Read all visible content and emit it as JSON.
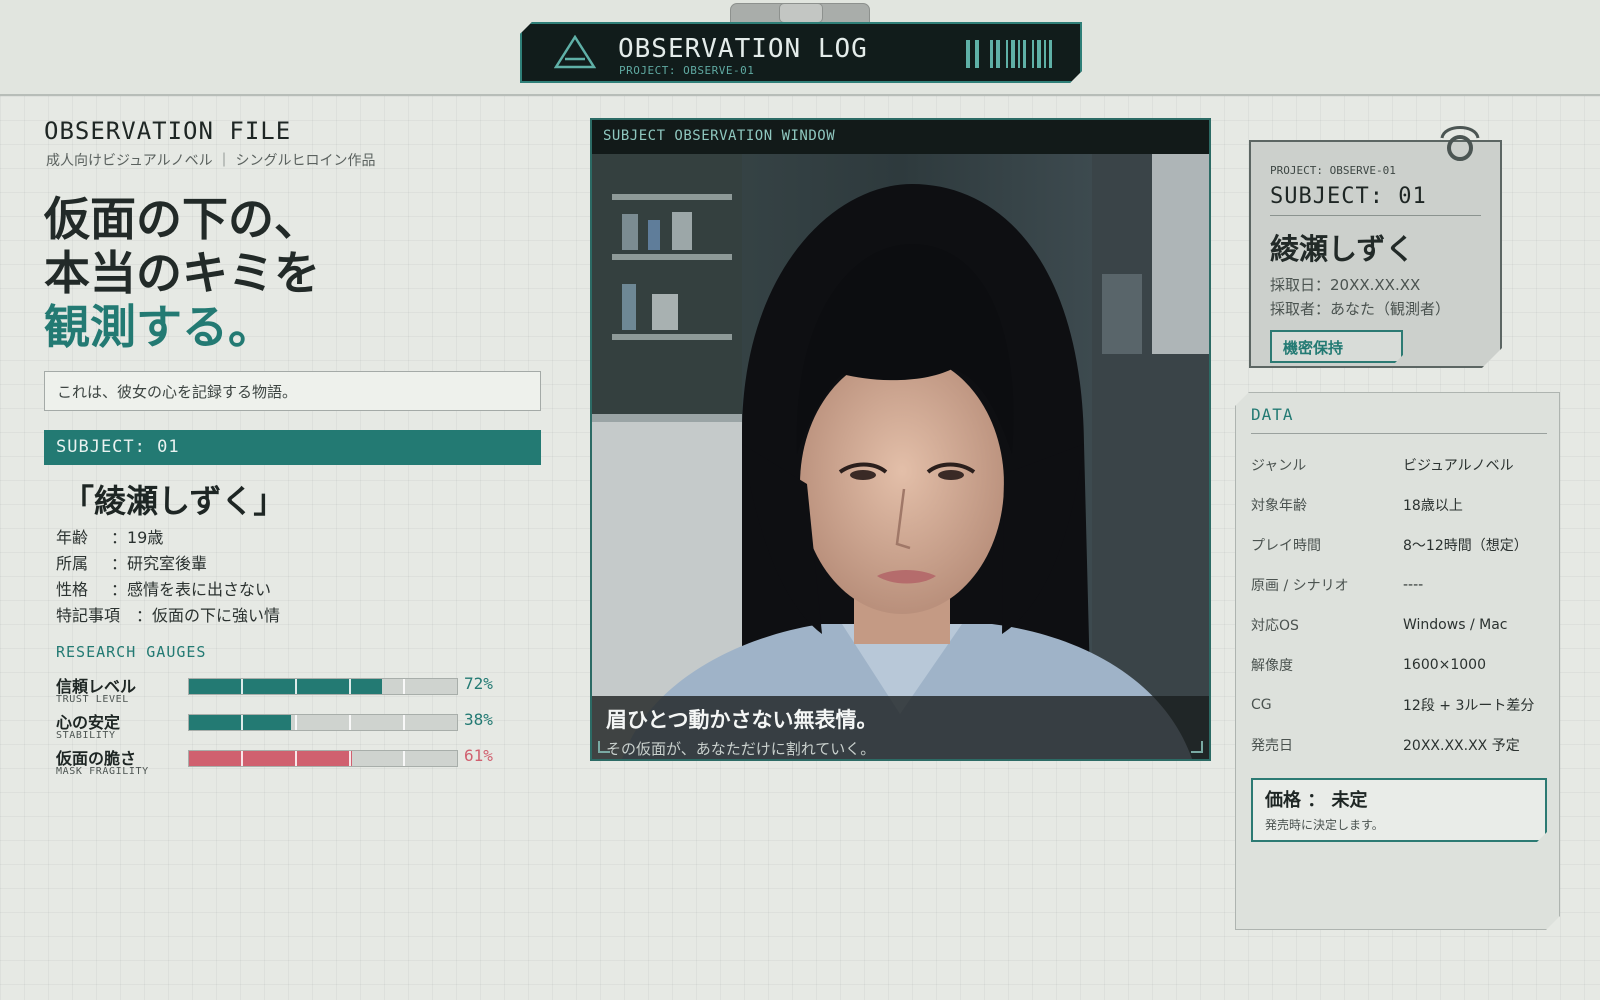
{
  "header": {
    "title": "OBSERVATION LOG",
    "subtitle": "PROJECT: OBSERVE-01",
    "icon": "triangle-icon",
    "barcode_icon": "barcode-icon"
  },
  "file": {
    "title": "OBSERVATION FILE",
    "subtitle": "成人向けビジュアルノベル ｜ シングルヒロイン作品",
    "headline_line1": "仮面の下の、",
    "headline_line2": "本当のキミを",
    "headline_line3": "観測する。",
    "tagline": "これは、彼女の心を記録する物語。"
  },
  "subject": {
    "bar_label": "SUBJECT: 01",
    "name": "「綾瀬しずく」",
    "profile": [
      {
        "key": "年齢",
        "sep": "：",
        "value": "19歳"
      },
      {
        "key": "所属",
        "sep": "：",
        "value": "研究室後輩"
      },
      {
        "key": "性格",
        "sep": "：",
        "value": "感情を表に出さない"
      },
      {
        "key": "特記事項",
        "sep": "：",
        "value": "仮面の下に強い情"
      }
    ]
  },
  "gauges": {
    "title": "RESEARCH GAUGES",
    "items": [
      {
        "label": "信頼レベル",
        "sub": "TRUST LEVEL",
        "value": 72,
        "text": "72%",
        "color": "#237a73"
      },
      {
        "label": "心の安定",
        "sub": "STABILITY",
        "value": 38,
        "text": "38%",
        "color": "#237a73"
      },
      {
        "label": "仮面の脆さ",
        "sub": "MASK FRAGILITY",
        "value": 61,
        "text": "61%",
        "color": "#d0606f"
      }
    ]
  },
  "window": {
    "title": "SUBJECT OBSERVATION WINDOW",
    "caption_main": "眉ひとつ動かさない無表情。",
    "caption_sub": "その仮面が、あなただけに割れていく。"
  },
  "id_card": {
    "project": "PROJECT: OBSERVE-01",
    "subject": "SUBJECT: 01",
    "name": "綾瀬しずく",
    "date": "採取日：20XX.XX.XX",
    "collector": "採取者：あなた（観測者）",
    "badge": "機密保持",
    "ring_icon": "ring-clip-icon"
  },
  "data": {
    "title": "DATA",
    "rows": [
      {
        "key": "ジャンル",
        "value": "ビジュアルノベル"
      },
      {
        "key": "対象年齢",
        "value": "18歳以上"
      },
      {
        "key": "プレイ時間",
        "value": "8〜12時間（想定）"
      },
      {
        "key": "原画 / シナリオ",
        "value": "----"
      },
      {
        "key": "対応OS",
        "value": "Windows / Mac"
      },
      {
        "key": "解像度",
        "value": "1600×1000"
      },
      {
        "key": "CG",
        "value": "12段 + 3ルート差分"
      },
      {
        "key": "発売日",
        "value": "20XX.XX.XX 予定"
      }
    ],
    "price_main": "価格 ： 未定",
    "price_sub": "発売時に決定します。"
  },
  "colors": {
    "accent": "#237a73",
    "alert": "#d0606f",
    "dark": "#111c1b",
    "background": "#e6e9e4"
  }
}
